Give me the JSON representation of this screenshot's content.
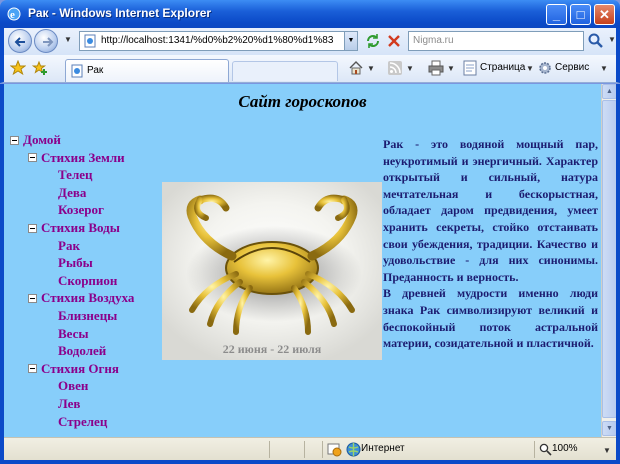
{
  "window": {
    "title": "Рак - Windows Internet Explorer",
    "buttons": {
      "minimize": "_",
      "maximize": "□",
      "close": "✕"
    }
  },
  "toolbar": {
    "address_url": "http://localhost:1341/%d0%b2%20%d1%80%d1%83",
    "search_placeholder": "Nigma.ru"
  },
  "tabs": [
    {
      "label": "Рак"
    }
  ],
  "commands": {
    "page_label": "Страница",
    "service_label": "Сервис"
  },
  "page": {
    "site_title": "Сайт гороскопов",
    "tree": {
      "root": "Домой",
      "groups": [
        {
          "label": "Стихия Земли",
          "items": [
            "Телец",
            "Дева",
            "Козерог"
          ]
        },
        {
          "label": "Стихия Воды",
          "items": [
            "Рак",
            "Рыбы",
            "Скорпион"
          ]
        },
        {
          "label": "Стихия Воздуха",
          "items": [
            "Близнецы",
            "Весы",
            "Водолей"
          ]
        },
        {
          "label": "Стихия Огня",
          "items": [
            "Овен",
            "Лев",
            "Стрелец"
          ]
        }
      ]
    },
    "image_caption": "22 июня - 22 июля",
    "description_p1": "Рак - это водяной мощный пар, неукротимый и энергичный. Характер открытый и сильный, натура мечтательная и бескорыстная, обладает даром предвидения, умеет хранить секреты, стойко отстаивать свои убеждения, традиции. Качество и удовольствие - для них синонимы. Преданность и верность.",
    "description_p2": "В древней мудрости именно люди знака Рак символизируют великий и беспокойный поток астральной материи, созидательной и пластичной."
  },
  "statusbar": {
    "zone": "Интернет",
    "zoom": "100%"
  },
  "colors": {
    "page_background": "#87cefa",
    "tree_link": "#8b008b",
    "description_text": "#1c1c70",
    "ie_frame": "#0b4ac8"
  }
}
